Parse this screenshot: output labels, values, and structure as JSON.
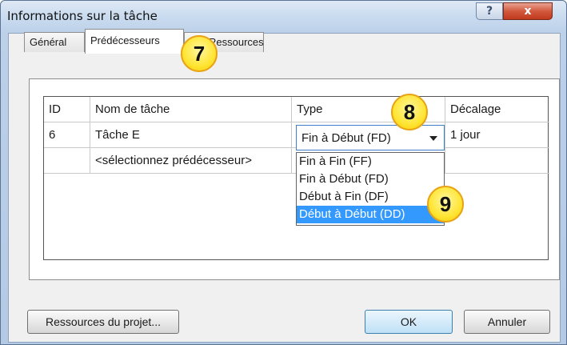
{
  "window": {
    "title": "Informations sur la tâche",
    "help_label": "?",
    "close_label": "x"
  },
  "tabs": [
    {
      "label": "Général"
    },
    {
      "label": "Prédécesseurs"
    },
    {
      "label": "Ressources"
    }
  ],
  "grid": {
    "headers": {
      "id": "ID",
      "name": "Nom de tâche",
      "type": "Type",
      "lag": "Décalage"
    },
    "rows": [
      {
        "id": "6",
        "name": "Tâche E",
        "type": "Fin à Début (FD)",
        "lag": "1 jour"
      },
      {
        "id": "",
        "name": "<sélectionnez prédécesseur>",
        "type": "",
        "lag": ""
      }
    ]
  },
  "type_dropdown": {
    "selected": "Fin à Début (FD)",
    "options": [
      "Fin à Fin (FF)",
      "Fin à Début (FD)",
      "Début à Fin (DF)",
      "Début à Début (DD)"
    ],
    "highlighted_index": 3
  },
  "callouts": [
    "7",
    "8",
    "9"
  ],
  "buttons": {
    "project_resources": "Ressources du projet...",
    "ok": "OK",
    "cancel": "Annuler"
  },
  "colors": {
    "highlight": "#3399ff",
    "callout_fill": "#ffe534",
    "callout_border": "#e8a317"
  }
}
